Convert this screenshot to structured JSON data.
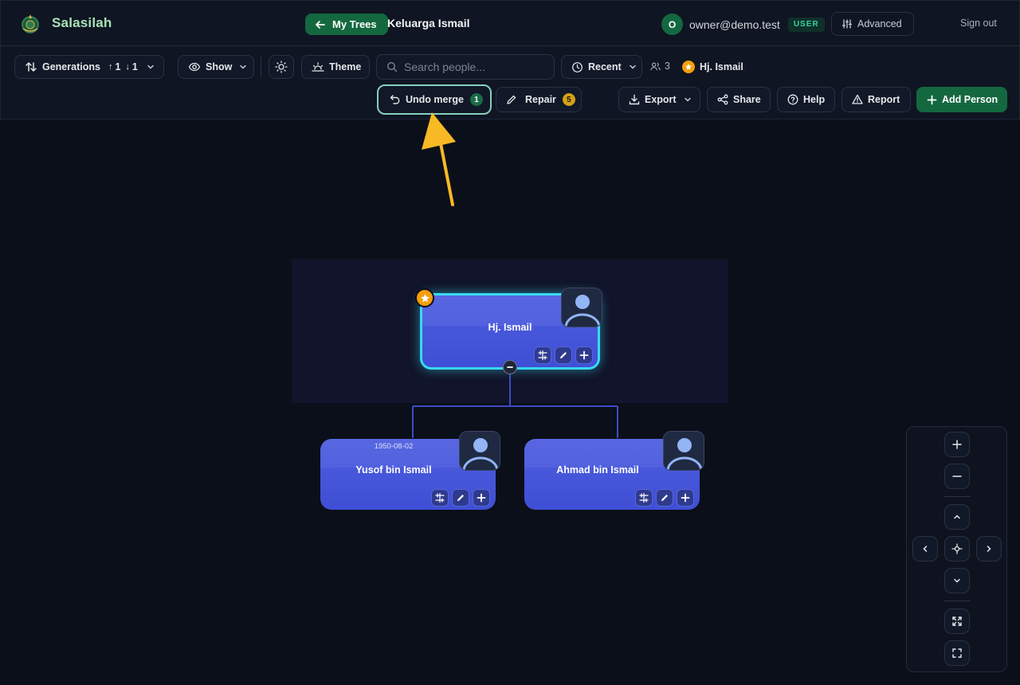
{
  "app": {
    "name": "Salasilah"
  },
  "header": {
    "my_trees_label": "My Trees",
    "tree_name": "Keluarga Ismail",
    "user_initial": "O",
    "user_email": "owner@demo.test",
    "user_role": "USER",
    "advanced_label": "Advanced",
    "signout_label": "Sign out"
  },
  "toolbar": {
    "generations_label": "Generations",
    "generations_up": "1",
    "generations_down": "1",
    "show_label": "Show",
    "theme_label": "Theme",
    "search_placeholder": "Search people...",
    "recent_label": "Recent",
    "people_count": "3",
    "focus_person": "Hj. Ismail",
    "undo_merge_label": "Undo merge",
    "undo_merge_count": "1",
    "repair_label": "Repair",
    "repair_count": "5",
    "export_label": "Export",
    "share_label": "Share",
    "help_label": "Help",
    "report_label": "Report",
    "add_person_label": "Add Person"
  },
  "tree": {
    "root": {
      "name": "Hj. Ismail",
      "starred": true,
      "selected": true
    },
    "children": [
      {
        "name": "Yusof bin Ismail",
        "date": "1950-08-02"
      },
      {
        "name": "Ahmad bin Ismail",
        "date": ""
      }
    ]
  },
  "colors": {
    "accent_green": "#14683f",
    "card_blue": "#4553d8",
    "selected_outline": "#38d9f0",
    "star": "#f59e0b",
    "annotation_arrow": "#f7b924"
  },
  "icons": {
    "zoom_controls": [
      "plus-icon",
      "minus-icon",
      "chevron-up-icon",
      "chevron-left-icon",
      "center-icon",
      "chevron-right-icon",
      "chevron-down-icon",
      "fit-icon",
      "fullscreen-icon"
    ]
  }
}
